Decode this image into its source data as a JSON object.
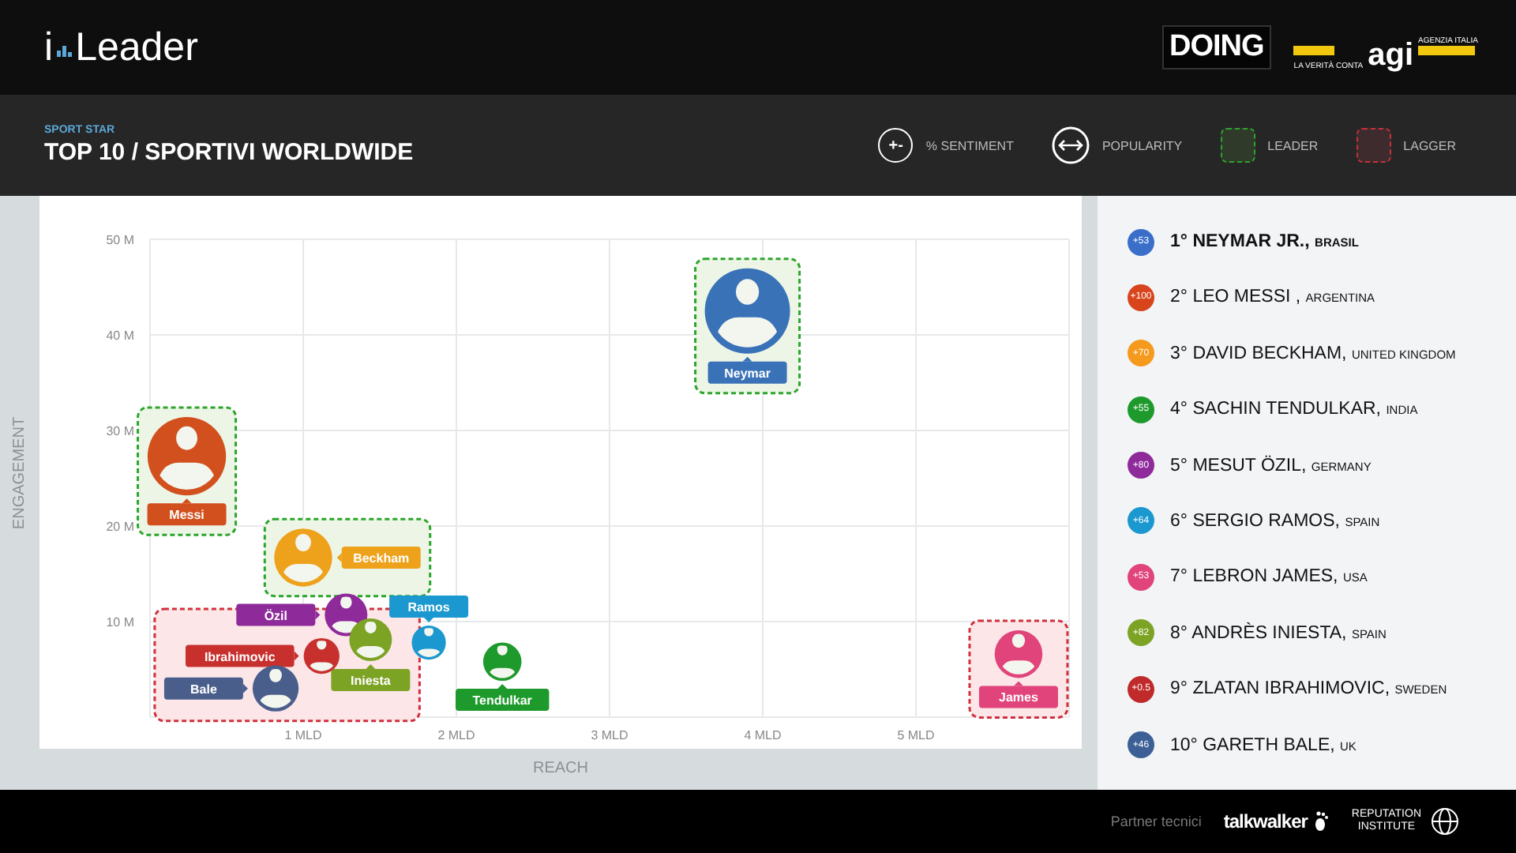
{
  "header": {
    "brand": {
      "prefix": "i",
      "name": "Leader"
    },
    "partners": [
      {
        "kind": "doing",
        "text": "DOING"
      },
      {
        "kind": "agi",
        "text": "agi",
        "tagline": "LA VERITÀ CONTA",
        "subtitle": "AGENZIA ITALIA"
      }
    ]
  },
  "title_bar": {
    "kicker": "SPORT STAR",
    "title": "TOP 10 / SPORTIVI WORLDWIDE",
    "legend": [
      {
        "kind": "sentiment",
        "symbol": "+-",
        "label": "% SENTIMENT"
      },
      {
        "kind": "popularity",
        "label": "POPULARITY"
      },
      {
        "kind": "leader",
        "label": "LEADER"
      },
      {
        "kind": "lagger",
        "label": "LAGGER"
      }
    ]
  },
  "chart_data": {
    "type": "scatter",
    "grid": true,
    "legend": true,
    "xlabel": "REACH",
    "ylabel": "ENGAGEMENT",
    "xlim": [
      0,
      6
    ],
    "ylim": [
      0,
      50
    ],
    "xticks": [
      {
        "value": 1,
        "label": "1 MLD"
      },
      {
        "value": 2,
        "label": "2 MLD"
      },
      {
        "value": 3,
        "label": "3 MLD"
      },
      {
        "value": 4,
        "label": "4 MLD"
      },
      {
        "value": 5,
        "label": "5 MLD"
      }
    ],
    "yticks": [
      {
        "value": 10,
        "label": "10 M"
      },
      {
        "value": 20,
        "label": "20 M"
      },
      {
        "value": 30,
        "label": "30 M"
      },
      {
        "value": 40,
        "label": "40 M"
      },
      {
        "value": 50,
        "label": "50 M"
      }
    ],
    "x": [
      3.9,
      0.24,
      1.0,
      1.28,
      1.82,
      1.44,
      1.12,
      0.82,
      2.3,
      5.67
    ],
    "series": [
      {
        "name": "Neymar",
        "color": "#3a72b8",
        "values": [
          42.5,
          null,
          null,
          null,
          null,
          null,
          null,
          null,
          null,
          null
        ]
      },
      {
        "name": "Messi",
        "color": "#d2501e",
        "values": [
          null,
          27.3,
          null,
          null,
          null,
          null,
          null,
          null,
          null,
          null
        ]
      },
      {
        "name": "Beckham",
        "color": "#eea21c",
        "values": [
          null,
          null,
          16.7,
          null,
          null,
          null,
          null,
          null,
          null,
          null
        ]
      },
      {
        "name": "Özil",
        "color": "#8e2a9a",
        "values": [
          null,
          null,
          null,
          10.7,
          null,
          null,
          null,
          null,
          null,
          null
        ]
      },
      {
        "name": "Ramos",
        "color": "#1a98cf",
        "values": [
          null,
          null,
          null,
          null,
          7.8,
          null,
          null,
          null,
          null,
          null
        ]
      },
      {
        "name": "Iniesta",
        "color": "#7da325",
        "values": [
          null,
          null,
          null,
          null,
          null,
          8.1,
          null,
          null,
          null,
          null
        ]
      },
      {
        "name": "Ibrahimovic",
        "color": "#c8302e",
        "values": [
          null,
          null,
          null,
          null,
          null,
          null,
          6.4,
          null,
          null,
          null
        ]
      },
      {
        "name": "Bale",
        "color": "#4a5e8c",
        "values": [
          null,
          null,
          null,
          null,
          null,
          null,
          null,
          3.0,
          null,
          null
        ]
      },
      {
        "name": "Tendulkar",
        "color": "#1e9a2c",
        "values": [
          null,
          null,
          null,
          null,
          null,
          null,
          null,
          null,
          5.8,
          null
        ]
      },
      {
        "name": "James",
        "color": "#e0447a",
        "values": [
          null,
          null,
          null,
          null,
          null,
          null,
          null,
          null,
          null,
          6.6
        ]
      }
    ]
  },
  "zones": [
    {
      "kind": "leader"
    },
    {
      "kind": "leader"
    },
    {
      "kind": "leader"
    },
    {
      "kind": "none"
    },
    {
      "kind": "none"
    },
    {
      "kind": "lagger"
    },
    {
      "kind": "lagger"
    },
    {
      "kind": "lagger"
    },
    {
      "kind": "none"
    },
    {
      "kind": "lagger"
    }
  ],
  "ranking": [
    {
      "badge": "+53",
      "color": "#3a6fc9",
      "rank": "1°",
      "name": "NEYMAR JR.,",
      "country": "BRASIL",
      "selected": true
    },
    {
      "badge": "+100",
      "color": "#d8441c",
      "rank": "2°",
      "name": "LEO MESSI ,",
      "country": "ARGENTINA",
      "selected": false
    },
    {
      "badge": "+70",
      "color": "#f59a1c",
      "rank": "3°",
      "name": "DAVID BECKHAM,",
      "country": "UNITED KINGDOM",
      "selected": false
    },
    {
      "badge": "+55",
      "color": "#1e9a2c",
      "rank": "4°",
      "name": "SACHIN TENDULKAR,",
      "country": "INDIA",
      "selected": false
    },
    {
      "badge": "+80",
      "color": "#8e2a9a",
      "rank": "5°",
      "name": "MESUT ÖZIL,",
      "country": "GERMANY",
      "selected": false
    },
    {
      "badge": "+64",
      "color": "#1a98cf",
      "rank": "6°",
      "name": "SERGIO RAMOS,",
      "country": "SPAIN",
      "selected": false
    },
    {
      "badge": "+53",
      "color": "#e0447a",
      "rank": "7°",
      "name": "LEBRON JAMES,",
      "country": "USA",
      "selected": false
    },
    {
      "badge": "+82",
      "color": "#7da325",
      "rank": "8°",
      "name": "ANDRÈS INIESTA,",
      "country": "SPAIN",
      "selected": false
    },
    {
      "badge": "+0.5",
      "color": "#c02a2a",
      "rank": "9°",
      "name": "ZLATAN IBRAHIMOVIC,",
      "country": "SWEDEN",
      "selected": false
    },
    {
      "badge": "+46",
      "color": "#3c5f96",
      "rank": "10°",
      "name": "GARETH BALE,",
      "country": "UK",
      "selected": false
    }
  ],
  "footer": {
    "label": "Partner tecnici",
    "partners": [
      {
        "kind": "talkwalker",
        "text": "talkwalker"
      },
      {
        "kind": "reputation",
        "lines": [
          "REPUTATION",
          "INSTITUTE"
        ]
      }
    ]
  }
}
